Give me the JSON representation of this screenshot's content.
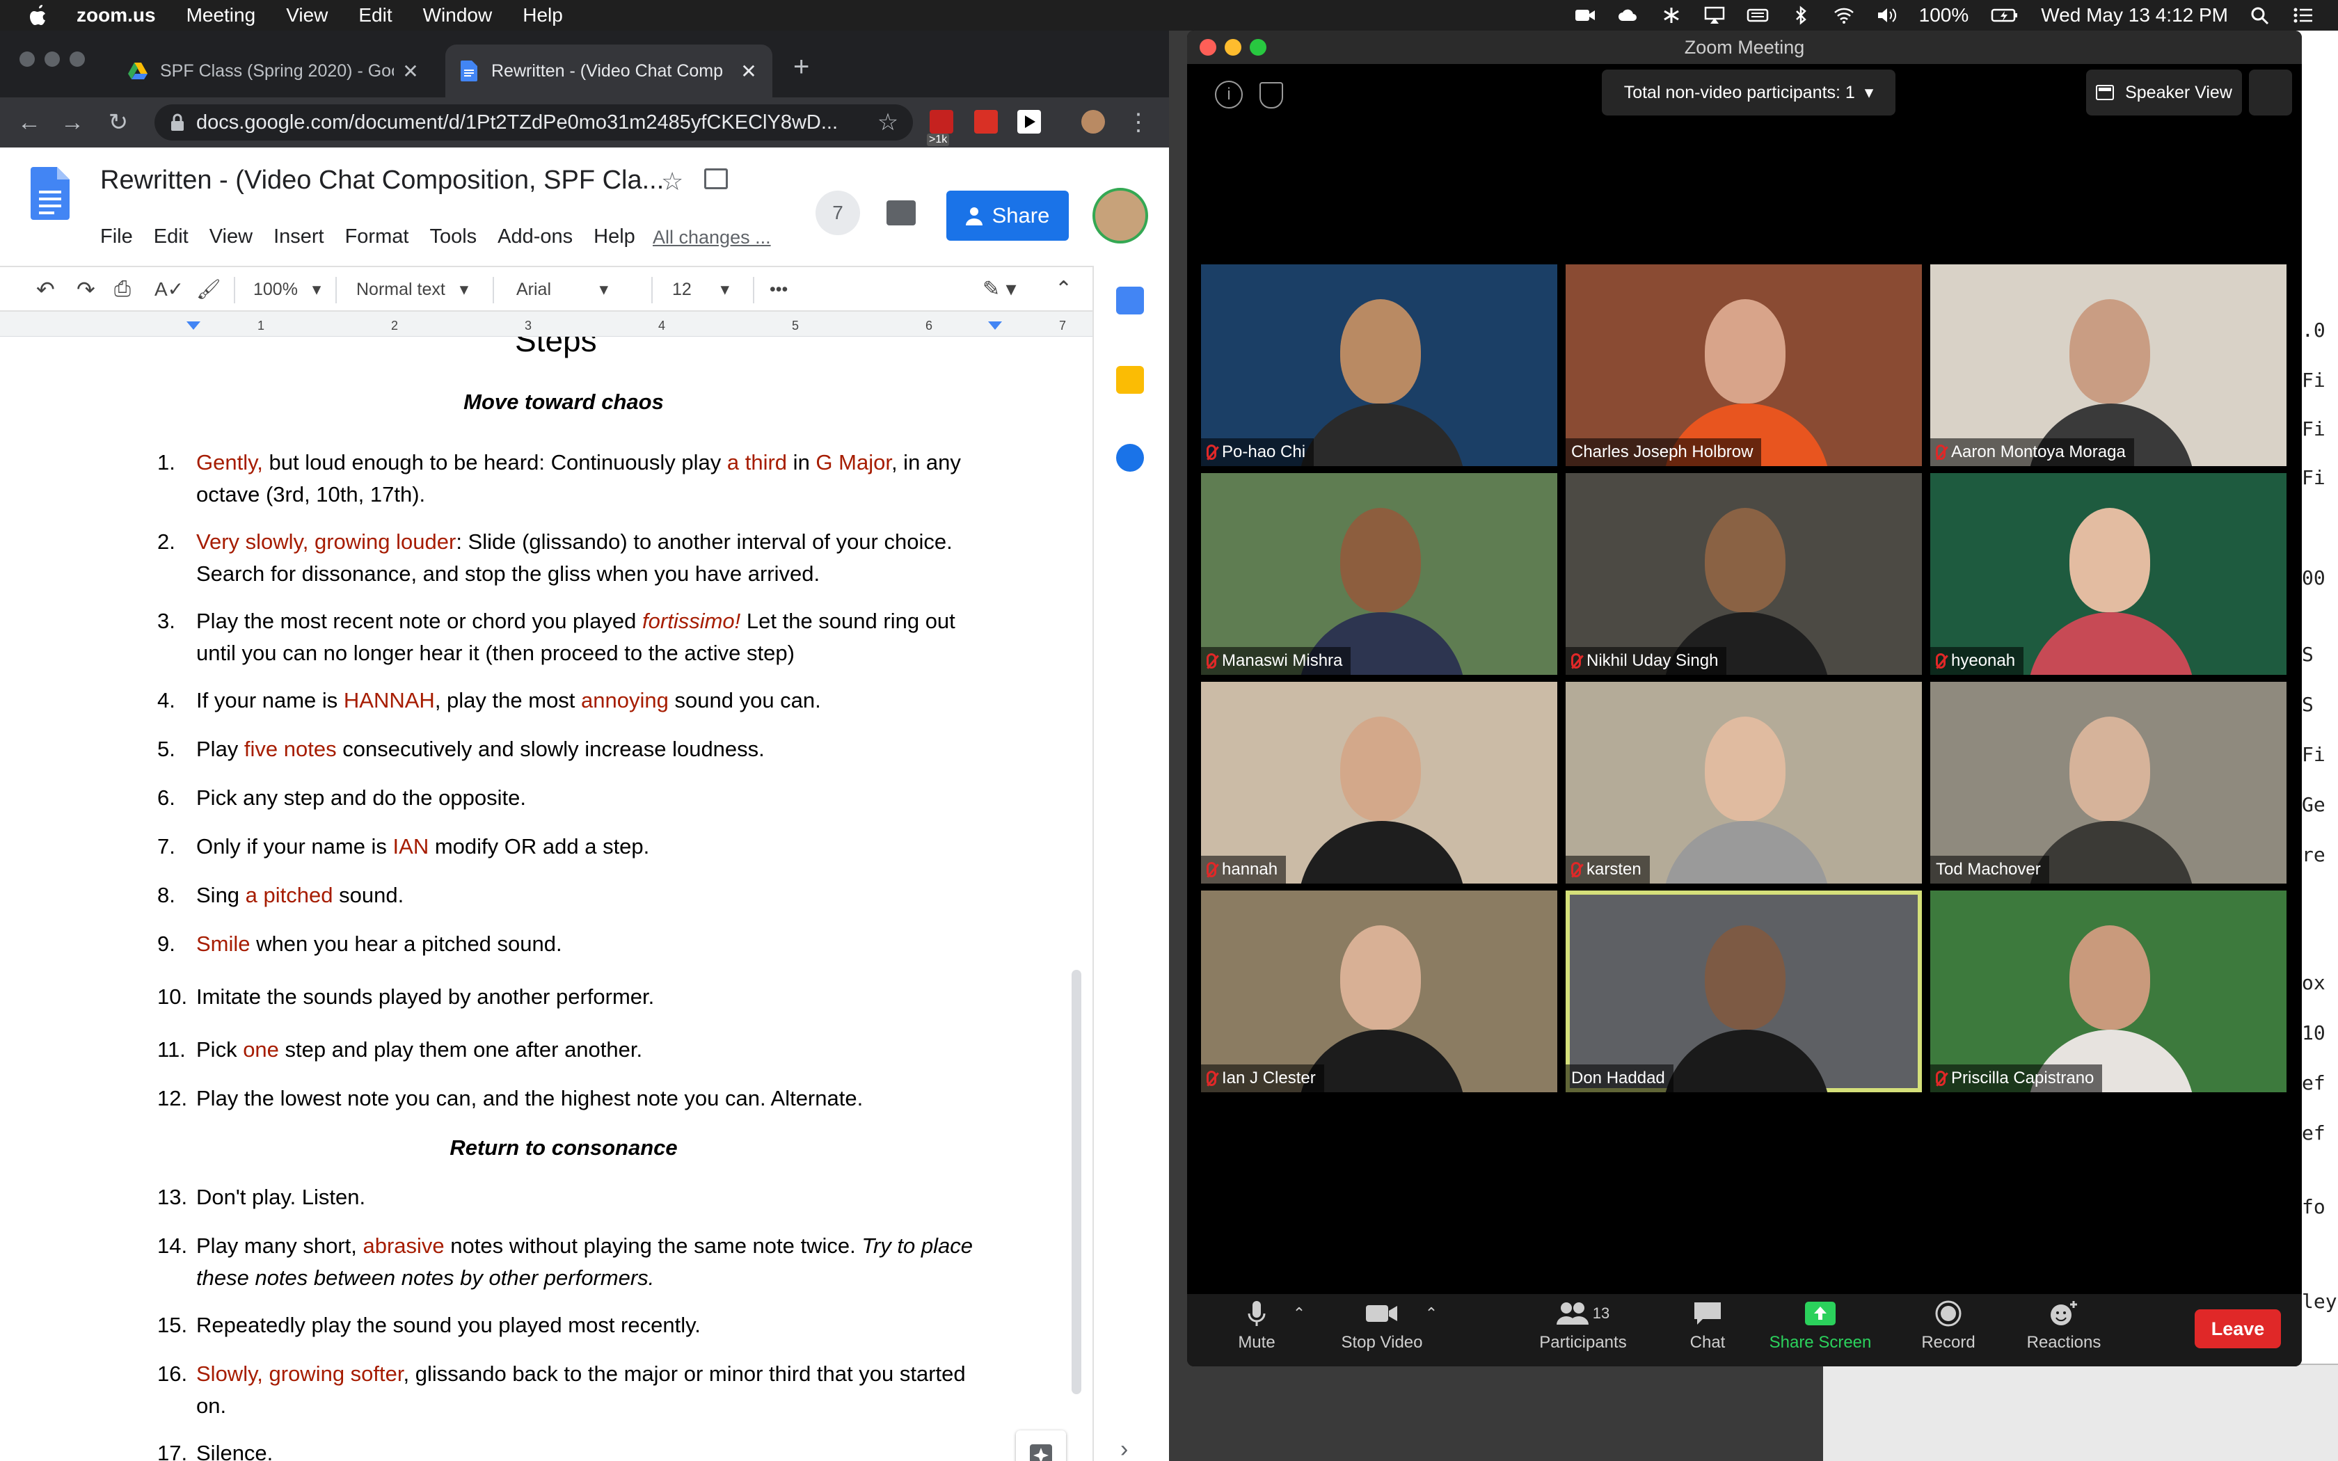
{
  "menubar": {
    "app_name": "zoom.us",
    "items": [
      "Meeting",
      "View",
      "Edit",
      "Window",
      "Help"
    ],
    "battery": "100%",
    "datetime": "Wed May 13  4:12 PM"
  },
  "chrome": {
    "tabs": [
      {
        "title": "SPF Class (Spring 2020) - Goo",
        "icon": "google-drive-icon"
      },
      {
        "title": "Rewritten - (Video Chat Comp",
        "icon": "google-docs-icon"
      }
    ],
    "new_tab": "+",
    "url": "docs.google.com/document/d/1Pt2TZdPe0mo31m2485yfCKEClY8wD...",
    "extension_badge": ">1k"
  },
  "docs": {
    "title": "Rewritten - (Video Chat Composition, SPF Cla...",
    "menu": [
      "File",
      "Edit",
      "View",
      "Insert",
      "Format",
      "Tools",
      "Add-ons",
      "Help"
    ],
    "all_changes": "All changes ...",
    "collaborators": "7",
    "share_label": "Share",
    "toolbar": {
      "zoom": "100%",
      "style": "Normal text",
      "font": "Arial",
      "size": "12",
      "more": "•••"
    },
    "ruler_ticks": [
      "1",
      "2",
      "3",
      "4",
      "5",
      "6",
      "7"
    ],
    "heading": "Steps",
    "section1": "Move toward chaos",
    "section2": "Return to consonance",
    "steps": [
      {
        "n": "1.",
        "parts": [
          [
            "Gently,",
            true
          ],
          [
            " but loud enough to be heard: Continuously play ",
            false
          ],
          [
            "a third",
            true
          ],
          [
            " in ",
            false
          ],
          [
            "G Major",
            true
          ],
          [
            ", in any octave (3rd, 10th, 17th).",
            false
          ]
        ]
      },
      {
        "n": "2.",
        "parts": [
          [
            "Very slowly, growing louder",
            true
          ],
          [
            ": Slide (glissando) to another interval of your choice. Search for dissonance, and stop the gliss when you have arrived.",
            false
          ]
        ]
      },
      {
        "n": "3.",
        "parts": [
          [
            "Play the most recent note or chord you played ",
            false
          ],
          [
            "fortissimo!",
            true,
            true
          ],
          [
            " Let the sound ring out until you can no longer hear it (then proceed to the active step)",
            false
          ]
        ]
      },
      {
        "n": "4.",
        "parts": [
          [
            "If your name is ",
            false
          ],
          [
            "HANNAH",
            true
          ],
          [
            ", play the most ",
            false
          ],
          [
            "annoying",
            true
          ],
          [
            " sound you can.",
            false
          ]
        ]
      },
      {
        "n": "5.",
        "parts": [
          [
            "Play ",
            false
          ],
          [
            "five notes",
            true
          ],
          [
            " consecutively and slowly increase loudness.",
            false
          ]
        ]
      },
      {
        "n": "6.",
        "parts": [
          [
            "Pick any step and do the opposite.",
            false
          ]
        ]
      },
      {
        "n": "7.",
        "parts": [
          [
            "Only if your name is ",
            false
          ],
          [
            "IAN",
            true
          ],
          [
            " modify OR add a step.",
            false
          ]
        ]
      },
      {
        "n": "8.",
        "parts": [
          [
            "Sing ",
            false
          ],
          [
            "a pitched",
            true
          ],
          [
            " sound.",
            false
          ]
        ]
      },
      {
        "n": "9.",
        "parts": [
          [
            "Smile",
            true
          ],
          [
            " when you hear a pitched sound.",
            false
          ]
        ]
      },
      {
        "n": "10.",
        "parts": [
          [
            "Imitate the sounds played by another performer.",
            false
          ]
        ]
      },
      {
        "n": "11.",
        "parts": [
          [
            "Pick ",
            false
          ],
          [
            "one",
            true
          ],
          [
            " step and play them one after another.",
            false
          ]
        ]
      },
      {
        "n": "12.",
        "parts": [
          [
            "Play the lowest note you can, and the highest note you can. Alternate.",
            false
          ]
        ]
      },
      {
        "n": "13.",
        "parts": [
          [
            "Don't play. Listen.",
            false
          ]
        ]
      },
      {
        "n": "14.",
        "parts": [
          [
            "Play many short, ",
            false
          ],
          [
            "abrasive",
            true
          ],
          [
            " notes without playing the same note twice. ",
            false
          ],
          [
            "Try to place these notes between notes by other performers.",
            false,
            true
          ]
        ]
      },
      {
        "n": "15.",
        "parts": [
          [
            "Repeatedly play the sound you played most recently.",
            false
          ]
        ]
      },
      {
        "n": "16.",
        "parts": [
          [
            "Slowly, growing softer",
            true
          ],
          [
            ", glissando back to the major or minor third that you started on.",
            false
          ]
        ]
      },
      {
        "n": "17.",
        "parts": [
          [
            "Silence.",
            false
          ]
        ]
      }
    ]
  },
  "zoom": {
    "window_title": "Zoom Meeting",
    "nonvideo": "Total non-video participants: 1",
    "speaker_view": "Speaker View",
    "participants": [
      {
        "name": "Po-hao Chi",
        "muted": true,
        "bg": "#1b3f66",
        "skin": "#b98a63",
        "shirt": "#2a2a2a"
      },
      {
        "name": "Charles Joseph Holbrow",
        "muted": false,
        "bg": "#8a4b33",
        "skin": "#d8a48a",
        "shirt": "#e8551f"
      },
      {
        "name": "Aaron Montoya Moraga",
        "muted": true,
        "bg": "#d9d2c7",
        "skin": "#c99d83",
        "shirt": "#3a3a3a"
      },
      {
        "name": "Manaswi Mishra",
        "muted": true,
        "bg": "#5f7d52",
        "skin": "#8d5e3e",
        "shirt": "#2d3550"
      },
      {
        "name": "Nikhil Uday Singh",
        "muted": true,
        "bg": "#4c4a44",
        "skin": "#8a6244",
        "shirt": "#1f1f1f"
      },
      {
        "name": "hyeonah",
        "muted": true,
        "bg": "#1e5b3f",
        "skin": "#e3bca1",
        "shirt": "#c74a55"
      },
      {
        "name": "hannah",
        "muted": true,
        "bg": "#cbbba6",
        "skin": "#d3a88a",
        "shirt": "#1e1e1e"
      },
      {
        "name": "karsten",
        "muted": true,
        "bg": "#b4ab98",
        "skin": "#e0bba0",
        "shirt": "#9a9a9a"
      },
      {
        "name": "Tod Machover",
        "muted": false,
        "bg": "#8f8a7e",
        "skin": "#d6b39a",
        "shirt": "#3b3a36"
      },
      {
        "name": "Ian J Clester",
        "muted": true,
        "bg": "#8b7c62",
        "skin": "#d8b095",
        "shirt": "#1c1c1c"
      },
      {
        "name": "Don Haddad",
        "muted": false,
        "bg": "#5e6064",
        "skin": "#7d5a44",
        "shirt": "#1a1a1a",
        "active": true
      },
      {
        "name": "Priscilla Capistrano",
        "muted": true,
        "bg": "#3d7a3d",
        "skin": "#c99a7c",
        "shirt": "#e7e3df"
      }
    ],
    "controls": {
      "mute": "Mute",
      "stop_video": "Stop Video",
      "participants": "Participants",
      "participants_count": "13",
      "chat": "Chat",
      "share_screen": "Share Screen",
      "record": "Record",
      "reactions": "Reactions",
      "leave": "Leave"
    }
  },
  "background_window": {
    "fragments": [
      ".0",
      "Fi",
      "Fi",
      "Fi",
      "00",
      "S",
      "S",
      "Fi",
      "Ge",
      "re",
      "ox",
      "10",
      "ef",
      "ef",
      "fo",
      "ley"
    ]
  }
}
